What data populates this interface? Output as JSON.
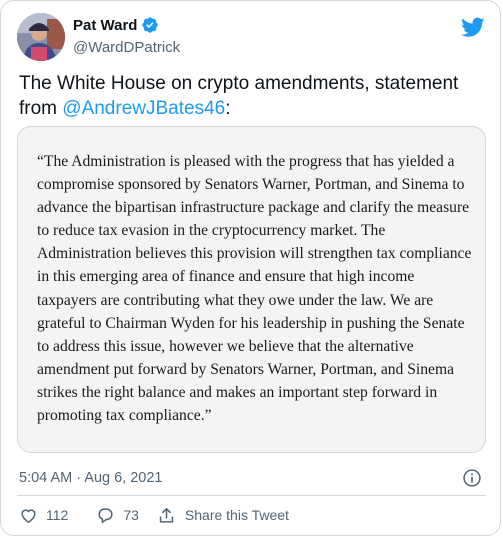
{
  "author": {
    "display_name": "Pat Ward",
    "handle": "@WardDPatrick",
    "verified": true
  },
  "tweet": {
    "text_prefix": "The White House on crypto amendments, statement from ",
    "mention": "@AndrewJBates46",
    "text_suffix": ":"
  },
  "media": {
    "statement_text": "“The Administration is pleased with the progress that has yielded a compromise sponsored by Senators Warner, Portman, and Sinema to advance the bipartisan infrastructure package and clarify the measure to reduce tax evasion in the cryptocurrency market. The Administration believes this provision will strengthen tax compliance in this emerging area of finance and ensure that high income taxpayers are contributing what they owe under the law. We are grateful to Chairman Wyden for his leadership in pushing the Senate to address this issue, however we believe that the alternative amendment put forward by Senators Warner, Portman, and Sinema strikes the right balance and makes an important step forward in promoting tax compliance.”"
  },
  "timestamp": "5:04 AM · Aug 6, 2021",
  "actions": {
    "likes": "112",
    "replies": "73",
    "share_label": "Share this Tweet"
  },
  "icons": {
    "verified": "verified-badge-icon",
    "bird": "twitter-bird-icon",
    "info": "info-icon",
    "like": "heart-icon",
    "reply": "reply-bubble-icon",
    "share": "share-arrow-icon"
  },
  "colors": {
    "accent": "#1d9bf0",
    "secondary_text": "#536471",
    "border": "#cfd9de"
  }
}
